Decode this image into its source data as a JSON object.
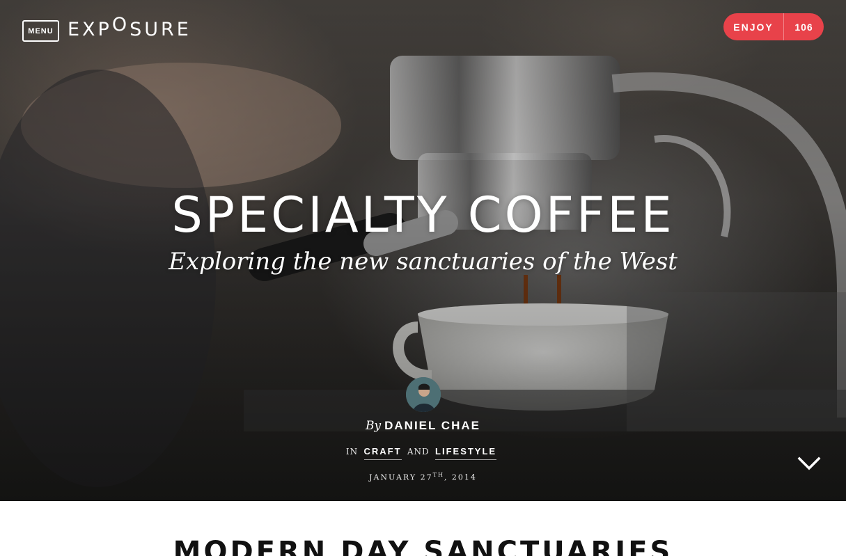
{
  "header": {
    "menu_label": "MENU",
    "logo_left": "EXP",
    "logo_o": "O",
    "logo_right": "SURE",
    "enjoy_label": "ENJOY",
    "enjoy_count": "106"
  },
  "hero": {
    "title": "SPECIALTY COFFEE",
    "subtitle": "Exploring the new sanctuaries of the West",
    "by_prefix": "By",
    "author": "DANIEL CHAE",
    "in_prefix": "IN",
    "category_1": "CRAFT",
    "and_word": "AND",
    "category_2": "LIFESTYLE",
    "date_main": "JANUARY 27",
    "date_suffix": "TH",
    "date_year": ", 2014"
  },
  "main": {
    "section_title": "MODERN DAY SANCTUARIES"
  },
  "icons": {
    "scroll": "chevron-down-icon",
    "avatar": "avatar"
  },
  "colors": {
    "accent": "#e8424a",
    "text_light": "#ffffff",
    "text_dark": "#111111"
  }
}
